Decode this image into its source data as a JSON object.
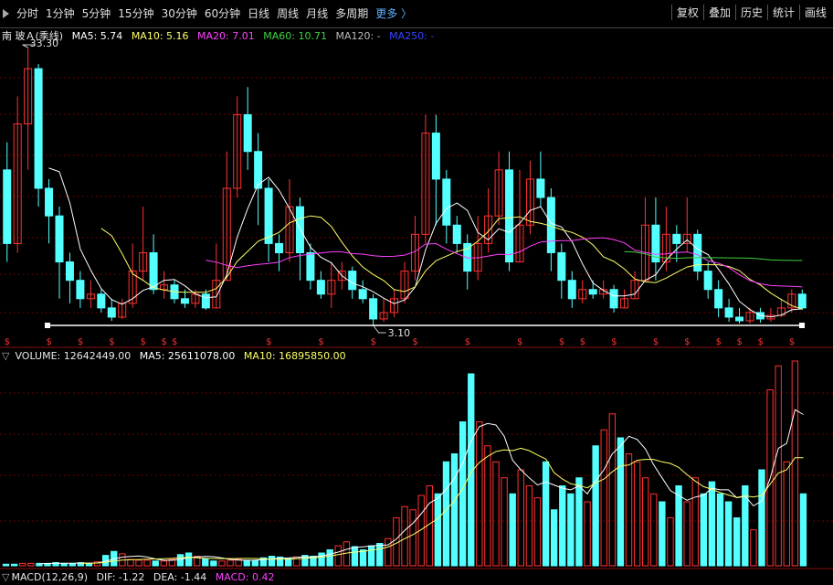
{
  "toolbar": {
    "left": [
      "分时",
      "1分钟",
      "5分钟",
      "15分钟",
      "30分钟",
      "60分钟",
      "日线",
      "周线",
      "月线",
      "多周期"
    ],
    "more": "更多",
    "right": [
      "复权",
      "叠加",
      "历史",
      "统计",
      "画线"
    ]
  },
  "price_legend": {
    "stock": "南 玻Ａ",
    "period": "(季线)",
    "ma5": "MA5: 5.74",
    "ma10": "MA10: 5.16",
    "ma20": "MA20: 7.01",
    "ma60": "MA60: 10.71",
    "ma120": "MA120: -",
    "ma250": "MA250: -"
  },
  "annotations": {
    "high": "33.30",
    "low": "3.10"
  },
  "volume_legend": {
    "volume": "VOLUME: 12642449.00",
    "ma5": "MA5: 25611078.00",
    "ma10": "MA10: 16895850.00"
  },
  "macd_legend": {
    "title": "MACD(12,26,9)",
    "dif": "DIF: -1.22",
    "dea": "DEA: -1.44",
    "macd": "MACD: 0.42"
  },
  "colors": {
    "up": "#ff3232",
    "down": "#54ffff",
    "ma5": "#ffffff",
    "ma10": "#ffff66",
    "ma20": "#ff40ff",
    "ma60": "#40d040",
    "ma120": "#bbbbbb",
    "ma250": "#3344ff",
    "marker": "#ff3232"
  },
  "chart_data": {
    "type": "candlestick",
    "price_range": [
      3.1,
      33.3
    ],
    "candles": [
      {
        "o": 20,
        "c": 12,
        "h": 23,
        "l": 10
      },
      {
        "o": 12,
        "c": 25,
        "h": 28,
        "l": 11
      },
      {
        "o": 25,
        "c": 31,
        "h": 33.3,
        "l": 20
      },
      {
        "o": 31,
        "c": 18,
        "h": 31.5,
        "l": 16
      },
      {
        "o": 18,
        "c": 15,
        "h": 19,
        "l": 12
      },
      {
        "o": 15,
        "c": 10,
        "h": 16,
        "l": 6
      },
      {
        "o": 10,
        "c": 8,
        "h": 11,
        "l": 5.5
      },
      {
        "o": 8,
        "c": 6,
        "h": 9,
        "l": 5
      },
      {
        "o": 6,
        "c": 6.5,
        "h": 8,
        "l": 5
      },
      {
        "o": 6.5,
        "c": 5,
        "h": 7,
        "l": 4.5
      },
      {
        "o": 5,
        "c": 4,
        "h": 6,
        "l": 3.6
      },
      {
        "o": 4,
        "c": 5.5,
        "h": 6,
        "l": 3.8
      },
      {
        "o": 5.5,
        "c": 9,
        "h": 12,
        "l": 5
      },
      {
        "o": 9,
        "c": 11,
        "h": 16,
        "l": 8
      },
      {
        "o": 11,
        "c": 7,
        "h": 13,
        "l": 6.5
      },
      {
        "o": 7,
        "c": 7.5,
        "h": 9,
        "l": 6
      },
      {
        "o": 7.5,
        "c": 6,
        "h": 8,
        "l": 5.5
      },
      {
        "o": 6,
        "c": 5.5,
        "h": 7,
        "l": 5
      },
      {
        "o": 5.5,
        "c": 6.5,
        "h": 7,
        "l": 5
      },
      {
        "o": 6.5,
        "c": 5,
        "h": 7,
        "l": 4.8
      },
      {
        "o": 5,
        "c": 8,
        "h": 12,
        "l": 5
      },
      {
        "o": 8,
        "c": 18,
        "h": 22,
        "l": 8
      },
      {
        "o": 18,
        "c": 26,
        "h": 28,
        "l": 17
      },
      {
        "o": 26,
        "c": 22,
        "h": 29,
        "l": 20
      },
      {
        "o": 22,
        "c": 18,
        "h": 24,
        "l": 14
      },
      {
        "o": 18,
        "c": 12,
        "h": 19,
        "l": 10
      },
      {
        "o": 12,
        "c": 11,
        "h": 13,
        "l": 9
      },
      {
        "o": 11,
        "c": 16,
        "h": 19,
        "l": 10
      },
      {
        "o": 16,
        "c": 11,
        "h": 17,
        "l": 8
      },
      {
        "o": 11,
        "c": 8,
        "h": 12,
        "l": 7
      },
      {
        "o": 8,
        "c": 6.5,
        "h": 9,
        "l": 6
      },
      {
        "o": 6.5,
        "c": 8,
        "h": 10,
        "l": 5
      },
      {
        "o": 8,
        "c": 9,
        "h": 10,
        "l": 7
      },
      {
        "o": 9,
        "c": 7,
        "h": 9.5,
        "l": 6
      },
      {
        "o": 7,
        "c": 6,
        "h": 8,
        "l": 5.5
      },
      {
        "o": 6,
        "c": 3.8,
        "h": 6.5,
        "l": 3.1
      },
      {
        "o": 3.8,
        "c": 4.5,
        "h": 6,
        "l": 3.5
      },
      {
        "o": 4.5,
        "c": 6,
        "h": 7,
        "l": 4
      },
      {
        "o": 6,
        "c": 9,
        "h": 10,
        "l": 5.5
      },
      {
        "o": 9,
        "c": 13,
        "h": 15,
        "l": 8
      },
      {
        "o": 13,
        "c": 24,
        "h": 26,
        "l": 12
      },
      {
        "o": 24,
        "c": 19,
        "h": 26,
        "l": 14
      },
      {
        "o": 19,
        "c": 14,
        "h": 20,
        "l": 12
      },
      {
        "o": 14,
        "c": 12,
        "h": 15,
        "l": 11
      },
      {
        "o": 12,
        "c": 9,
        "h": 13,
        "l": 7
      },
      {
        "o": 9,
        "c": 12,
        "h": 15,
        "l": 8
      },
      {
        "o": 12,
        "c": 15,
        "h": 18,
        "l": 11
      },
      {
        "o": 15,
        "c": 20,
        "h": 22,
        "l": 14
      },
      {
        "o": 20,
        "c": 10,
        "h": 22,
        "l": 9
      },
      {
        "o": 10,
        "c": 14,
        "h": 20,
        "l": 10
      },
      {
        "o": 14,
        "c": 19,
        "h": 21,
        "l": 13
      },
      {
        "o": 19,
        "c": 17,
        "h": 22,
        "l": 16
      },
      {
        "o": 17,
        "c": 11,
        "h": 18,
        "l": 9
      },
      {
        "o": 11,
        "c": 8,
        "h": 12,
        "l": 6
      },
      {
        "o": 8,
        "c": 6,
        "h": 9,
        "l": 5
      },
      {
        "o": 6,
        "c": 7,
        "h": 8,
        "l": 5.5
      },
      {
        "o": 7,
        "c": 6.5,
        "h": 8,
        "l": 6
      },
      {
        "o": 6.5,
        "c": 7,
        "h": 8,
        "l": 6
      },
      {
        "o": 7,
        "c": 5,
        "h": 7.5,
        "l": 4.5
      },
      {
        "o": 5,
        "c": 6,
        "h": 7,
        "l": 5
      },
      {
        "o": 6,
        "c": 8,
        "h": 9,
        "l": 6
      },
      {
        "o": 8,
        "c": 14,
        "h": 17,
        "l": 8
      },
      {
        "o": 14,
        "c": 10,
        "h": 17,
        "l": 8
      },
      {
        "o": 10,
        "c": 13,
        "h": 16,
        "l": 9
      },
      {
        "o": 13,
        "c": 12,
        "h": 14,
        "l": 10
      },
      {
        "o": 12,
        "c": 13,
        "h": 17,
        "l": 11
      },
      {
        "o": 13,
        "c": 9,
        "h": 13.5,
        "l": 8
      },
      {
        "o": 9,
        "c": 7,
        "h": 10,
        "l": 6
      },
      {
        "o": 7,
        "c": 5,
        "h": 8,
        "l": 4
      },
      {
        "o": 5,
        "c": 4,
        "h": 6,
        "l": 3.5
      },
      {
        "o": 4,
        "c": 3.6,
        "h": 5,
        "l": 3.3
      },
      {
        "o": 3.6,
        "c": 4.5,
        "h": 5,
        "l": 3.3
      },
      {
        "o": 4.5,
        "c": 3.8,
        "h": 5,
        "l": 3.4
      },
      {
        "o": 3.8,
        "c": 4.2,
        "h": 5,
        "l": 3.5
      },
      {
        "o": 4.2,
        "c": 5,
        "h": 6,
        "l": 4
      },
      {
        "o": 5,
        "c": 6.5,
        "h": 7,
        "l": 4.5
      },
      {
        "o": 6.5,
        "c": 5,
        "h": 7,
        "l": 4.8
      }
    ],
    "volume": [
      0.2,
      0.2,
      0.3,
      0.3,
      0.3,
      0.3,
      0.4,
      0.3,
      0.3,
      0.4,
      0.3,
      0.5,
      1.3,
      1.8,
      1.5,
      0.8,
      0.7,
      0.7,
      0.6,
      0.6,
      0.8,
      1.4,
      1.6,
      1.2,
      0.9,
      0.6,
      0.6,
      0.7,
      0.8,
      0.7,
      0.7,
      1.0,
      1.2,
      1.1,
      0.9,
      1.1,
      1.3,
      1.2,
      1.6,
      2.0,
      2.5,
      3.0,
      2.4,
      2.0,
      2.5,
      2.8,
      3.4,
      6.0,
      7.4,
      7.0,
      8.8,
      10.0,
      9.0,
      13.0,
      14.0,
      18.0,
      24.0,
      18.0,
      15.0,
      13.0,
      11.0,
      9.0,
      12.0,
      10.0,
      8.5,
      13.0,
      7.0,
      10.0,
      9.0,
      11.0,
      8.0,
      15.0,
      17.0,
      19.0,
      16.0,
      14.0,
      13.0,
      11.0,
      9.0,
      8.0,
      6.0,
      10.0,
      8.0,
      11.0,
      9.0,
      10.5,
      9.0,
      8.0,
      6.0,
      10.0,
      4.5,
      12.0,
      22.0,
      25.0,
      13.0,
      25.6,
      9.0
    ],
    "ma_lines": [
      "MA5",
      "MA10",
      "MA20",
      "MA60"
    ]
  }
}
